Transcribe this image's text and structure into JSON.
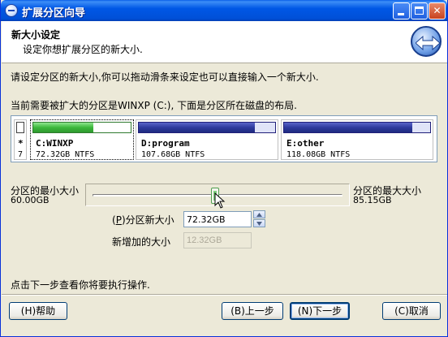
{
  "window": {
    "title": "扩展分区向导"
  },
  "header": {
    "title": "新大小设定",
    "subtitle": "设定你想扩展分区的新大小."
  },
  "instructions": {
    "line1": "请设定分区的新大小,你可以拖动滑条来设定也可以直接输入一个新大小.",
    "line2": "当前需要被扩大的分区是WINXP (C:), 下面是分区所在磁盘的布局."
  },
  "disk_map": {
    "partitions": [
      {
        "name": "*",
        "size": "7",
        "fill_fraction": 0.0
      },
      {
        "name": "C:WINXP",
        "size": "72.32GB NTFS",
        "fill_fraction": 0.62
      },
      {
        "name": "D:program",
        "size": "107.68GB NTFS",
        "fill_fraction": 0.85
      },
      {
        "name": "E:other",
        "size": "118.08GB NTFS",
        "fill_fraction": 0.88
      }
    ]
  },
  "slider": {
    "min_label": "分区的最小大小",
    "min_value": "60.00GB",
    "max_label": "分区的最大大小",
    "max_value": "85.15GB",
    "position_fraction": 0.49
  },
  "new_size": {
    "label_hotkey": "P",
    "label": "分区新大小",
    "value": "72.32GB"
  },
  "added_size": {
    "label": "新增加的大小",
    "value": "12.32GB"
  },
  "footer": {
    "text": "点击下一步查看你将要执行操作."
  },
  "buttons": {
    "help": "(H)帮助",
    "back": "(B)上一步",
    "next": "(N)下一步",
    "cancel": "(C)取消"
  },
  "colors": {
    "titlebar": "#0054e3",
    "system_partition": "#3cb83c",
    "data_partition": "#2e3a9e",
    "dialog_bg": "#ece9d8"
  }
}
